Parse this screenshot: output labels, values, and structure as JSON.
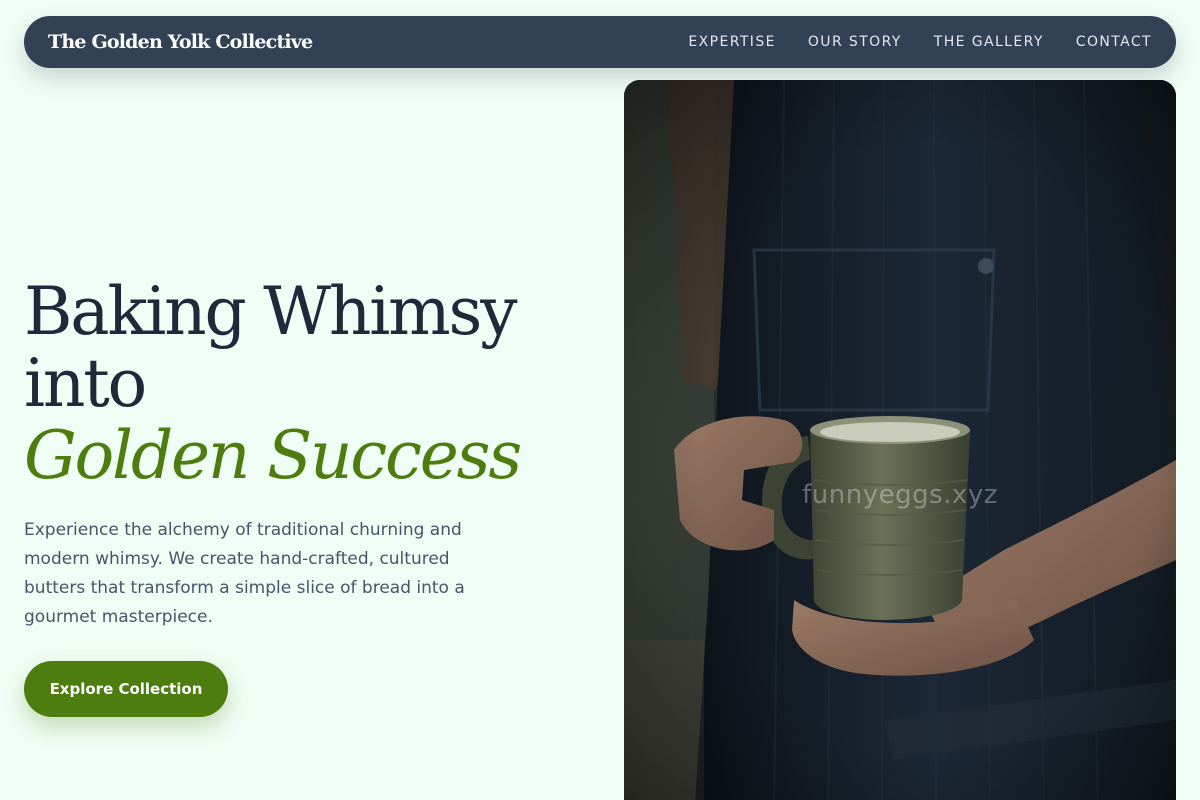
{
  "brand": {
    "name": "The Golden Yolk Collective"
  },
  "nav": {
    "items": [
      {
        "label": "EXPERTISE"
      },
      {
        "label": "OUR STORY"
      },
      {
        "label": "THE GALLERY"
      },
      {
        "label": "CONTACT"
      }
    ]
  },
  "hero": {
    "headline_line1": "Baking Whimsy",
    "headline_line2": "into",
    "headline_accent": "Golden Success",
    "description": "Experience the alchemy of traditional churning and modern whimsy. We create hand-crafted, cultured butters that transform a simple slice of bread into a gourmet masterpiece.",
    "cta_label": "Explore Collection",
    "image_watermark": "funnyeggs.xyz"
  },
  "colors": {
    "background": "#f0fdf4",
    "nav_background": "#334155",
    "heading": "#1e293b",
    "accent": "#4d7c0f",
    "body_text": "#475569"
  }
}
